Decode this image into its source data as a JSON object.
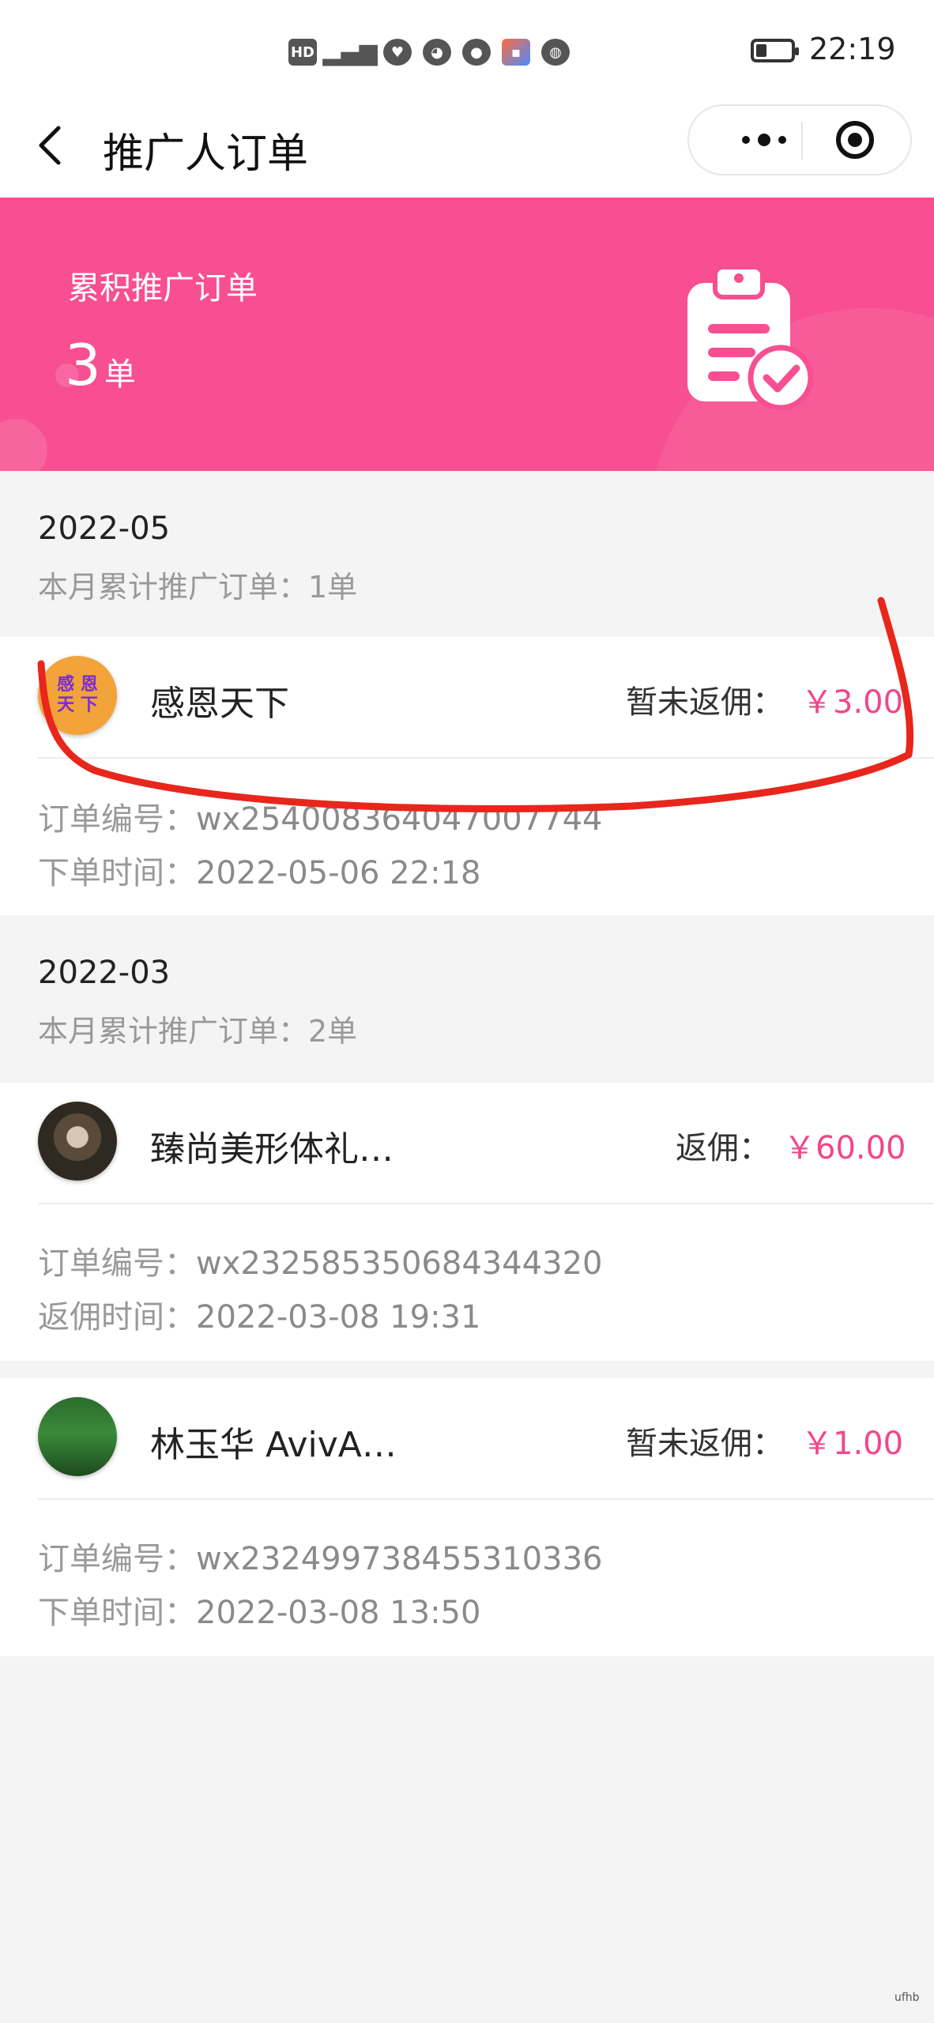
{
  "status_bar": {
    "icons": [
      "HD",
      "5G",
      "health-icon",
      "wechat-icon",
      "chat-icon",
      "app-icon",
      "browser-icon"
    ],
    "time": "22:19",
    "battery_level": 0.3
  },
  "nav": {
    "title": "推广人订单"
  },
  "banner": {
    "label": "累积推广订单",
    "count": "3",
    "unit": "单",
    "color": "#f74f91"
  },
  "months": [
    {
      "month": "2022-05",
      "summary": "本月累计推广订单：1单",
      "orders": [
        {
          "avatar_text": [
            "感 恩",
            "天 下"
          ],
          "name": "感恩天下",
          "rebate_label": "暂未返佣：",
          "amount": "￥3.00",
          "order_no_label": "订单编号：",
          "order_no": "wx254008364047007744",
          "time_label": "下单时间：",
          "time": "2022-05-06 22:18"
        }
      ]
    },
    {
      "month": "2022-03",
      "summary": "本月累计推广订单：2单",
      "orders": [
        {
          "name": "臻尚美形体礼…",
          "rebate_label": "返佣：",
          "amount": "￥60.00",
          "order_no_label": "订单编号：",
          "order_no": "wx232585350684344320",
          "time_label": "返佣时间：",
          "time": "2022-03-08 19:31"
        },
        {
          "name": "林玉华 AvivA…",
          "rebate_label": "暂未返佣：",
          "amount": "￥1.00",
          "order_no_label": "订单编号：",
          "order_no": "wx232499738455310336",
          "time_label": "下单时间：",
          "time": "2022-03-08 13:50"
        }
      ]
    }
  ],
  "colors": {
    "accent": "#f0478a",
    "annotation": "#e8261c"
  },
  "watermark": "ufhb"
}
